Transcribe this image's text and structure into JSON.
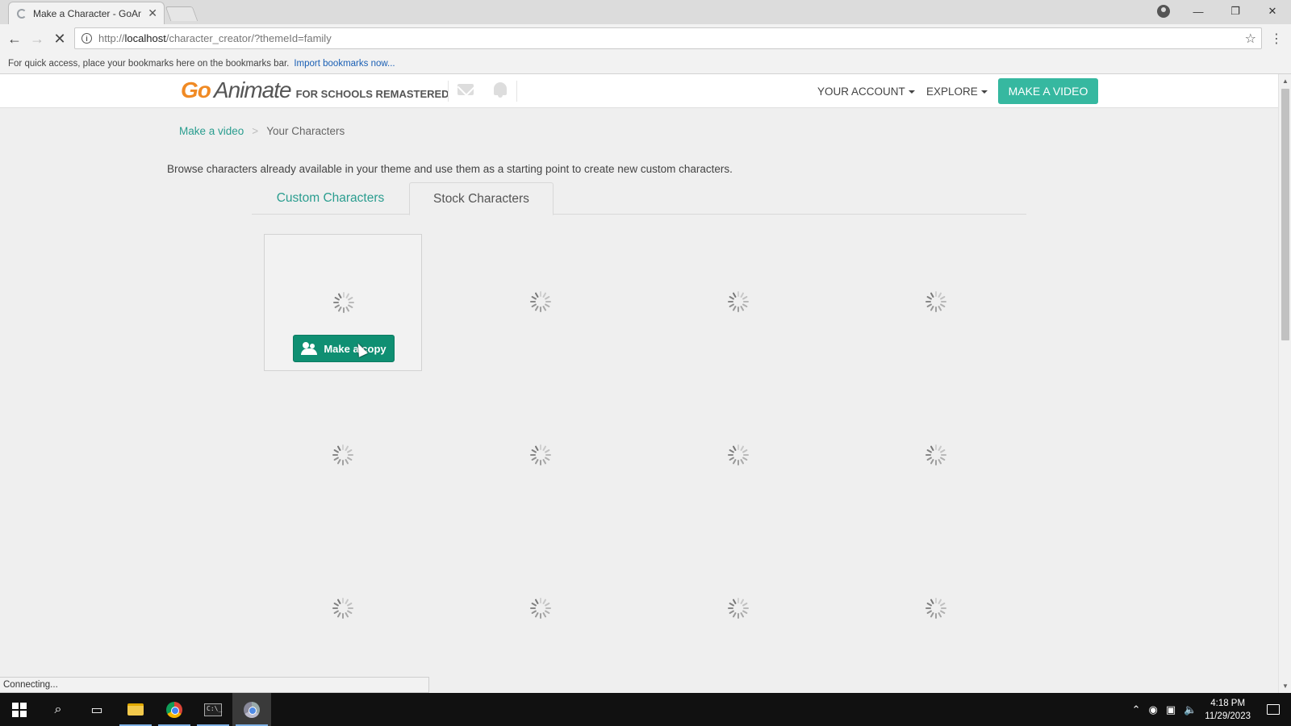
{
  "browser": {
    "tab_title": "Make a Character - GoAn",
    "tab_close": "✕",
    "url_scheme": "http://",
    "url_host": "localhost",
    "url_path": "/character_creator/?themeId=family",
    "bookmarks_hint": "For quick access, place your bookmarks here on the bookmarks bar.",
    "import_bookmarks": "Import bookmarks now...",
    "status_text": "Connecting...",
    "back_glyph": "←",
    "forward_glyph": "→",
    "stop_glyph": "✕",
    "minimize_glyph": "—",
    "restore_glyph": "❐",
    "close_glyph": "✕",
    "star_glyph": "☆",
    "menu_glyph": "⋮"
  },
  "header": {
    "logo_go": "Go",
    "logo_animate": "Animate",
    "logo_sub": "FOR SCHOOLS REMASTERED",
    "your_account": "YOUR ACCOUNT",
    "explore": "EXPLORE",
    "make_video": "MAKE A VIDEO"
  },
  "breadcrumb": {
    "link": "Make a video",
    "separator": ">",
    "current": "Your Characters"
  },
  "intro": "Browse characters already available in your theme and use them as a starting point to create new custom characters.",
  "tabs": {
    "custom": "Custom Characters",
    "stock": "Stock Characters",
    "active": "stock"
  },
  "grid": {
    "copy_button": "Make a copy",
    "cells_loading": 12
  },
  "taskbar": {
    "time": "4:18 PM",
    "date": "11/29/2023"
  },
  "colors": {
    "accent": "#36b8a0",
    "copy_button": "#0f8f72",
    "link": "#2a9d8f",
    "logo_orange": "#f08a24"
  }
}
